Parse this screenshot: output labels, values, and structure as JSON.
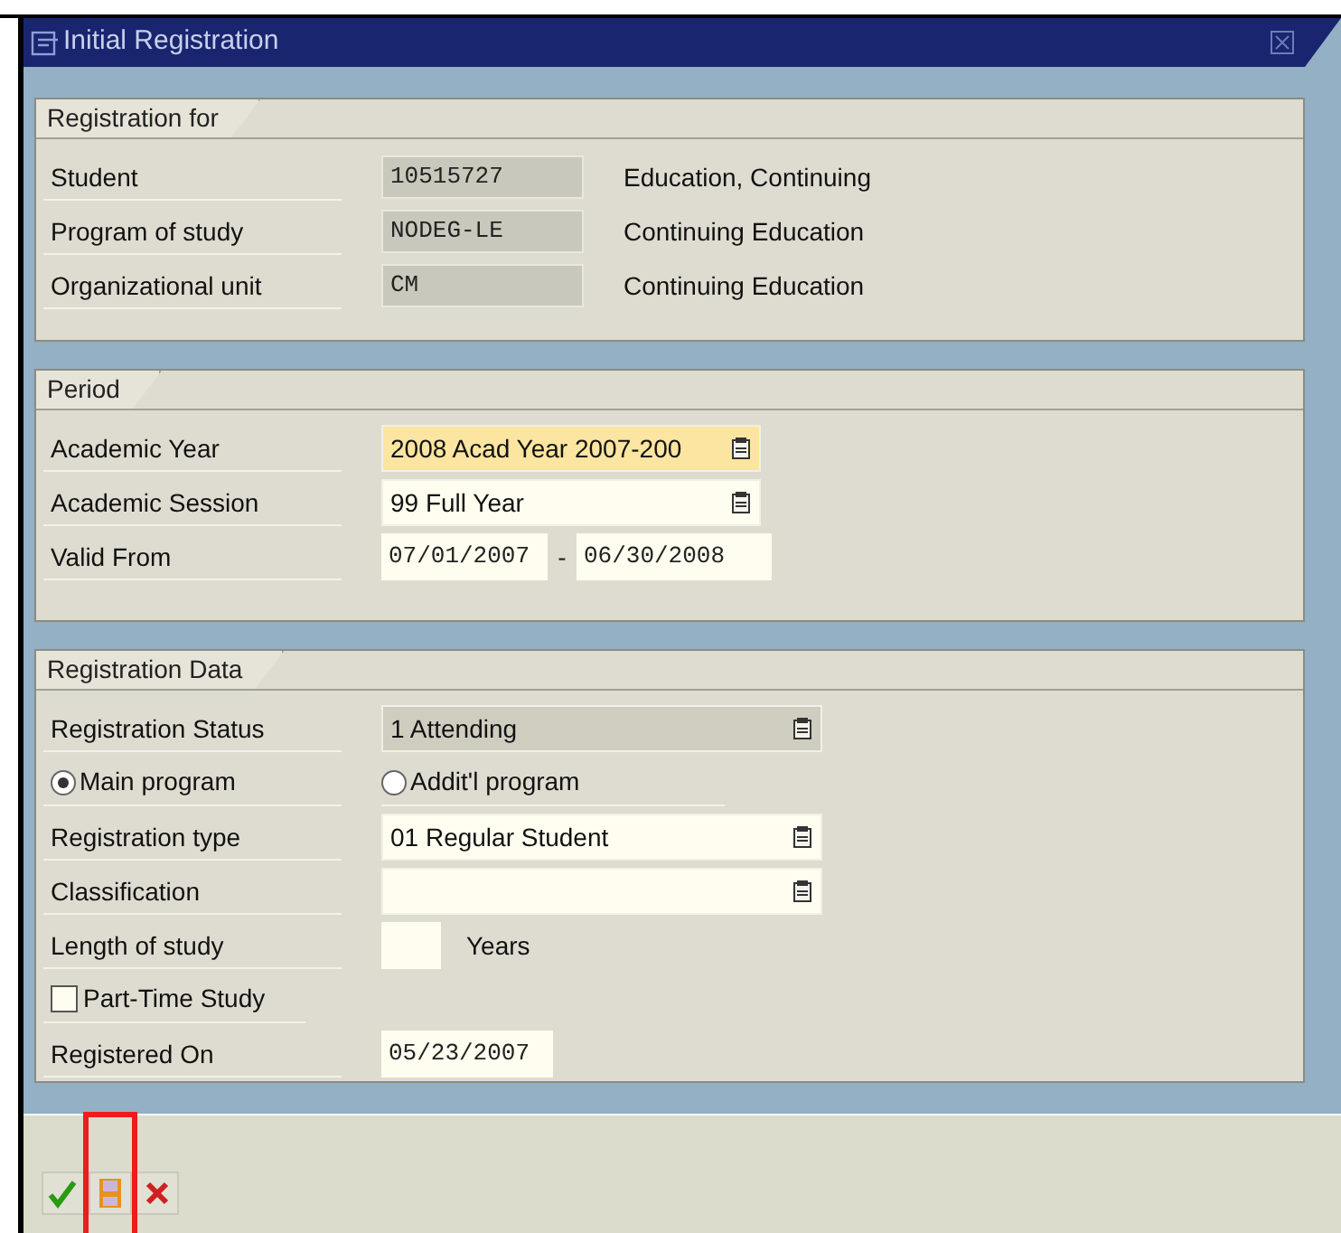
{
  "window": {
    "title": "Initial Registration"
  },
  "groups": [
    {
      "title": "Registration for",
      "rows": [
        {
          "kind": "display",
          "label": "Student",
          "value": "10515727",
          "description": "Education, Continuing"
        },
        {
          "kind": "display",
          "label": "Program of study",
          "value": "NODEG-LE",
          "description": "Continuing Education"
        },
        {
          "kind": "display",
          "label": "Organizational unit",
          "value": "CM",
          "description": "Continuing Education"
        }
      ]
    },
    {
      "title": "Period",
      "rows": [
        {
          "kind": "dropdown",
          "label": "Academic Year",
          "value": "2008 Acad Year 2007-200",
          "focused": true,
          "readonly": false
        },
        {
          "kind": "dropdown",
          "label": "Academic Session",
          "value": "99 Full Year",
          "focused": false,
          "readonly": false
        },
        {
          "kind": "range",
          "label": "Valid From",
          "from": "07/01/2007",
          "separator": "-",
          "to": "06/30/2008"
        }
      ]
    },
    {
      "title": "Registration Data",
      "rows": [
        {
          "kind": "dropdown",
          "label": "Registration Status",
          "value": "1 Attending",
          "focused": false,
          "readonly": true,
          "wide": true
        },
        {
          "kind": "radios",
          "options": [
            {
              "label": "Main program",
              "selected": true
            },
            {
              "label": "Addit'l program",
              "selected": false
            }
          ]
        },
        {
          "kind": "dropdown",
          "label": "Registration type",
          "value": "01 Regular Student",
          "focused": false,
          "readonly": false,
          "wide": true
        },
        {
          "kind": "dropdown",
          "label": "Classification",
          "focused": false,
          "readonly": false,
          "wide": true
        },
        {
          "kind": "input",
          "label": "Length of study",
          "unit": "Years"
        },
        {
          "kind": "checkbox",
          "label": "Part-Time Study",
          "checked": false
        },
        {
          "kind": "input",
          "label": "Registered On",
          "value": "05/23/2007"
        }
      ]
    }
  ],
  "toolbar": [
    {
      "kind": "confirm",
      "highlighted": false
    },
    {
      "kind": "save",
      "highlighted": true
    },
    {
      "kind": "cancel",
      "highlighted": false
    }
  ]
}
